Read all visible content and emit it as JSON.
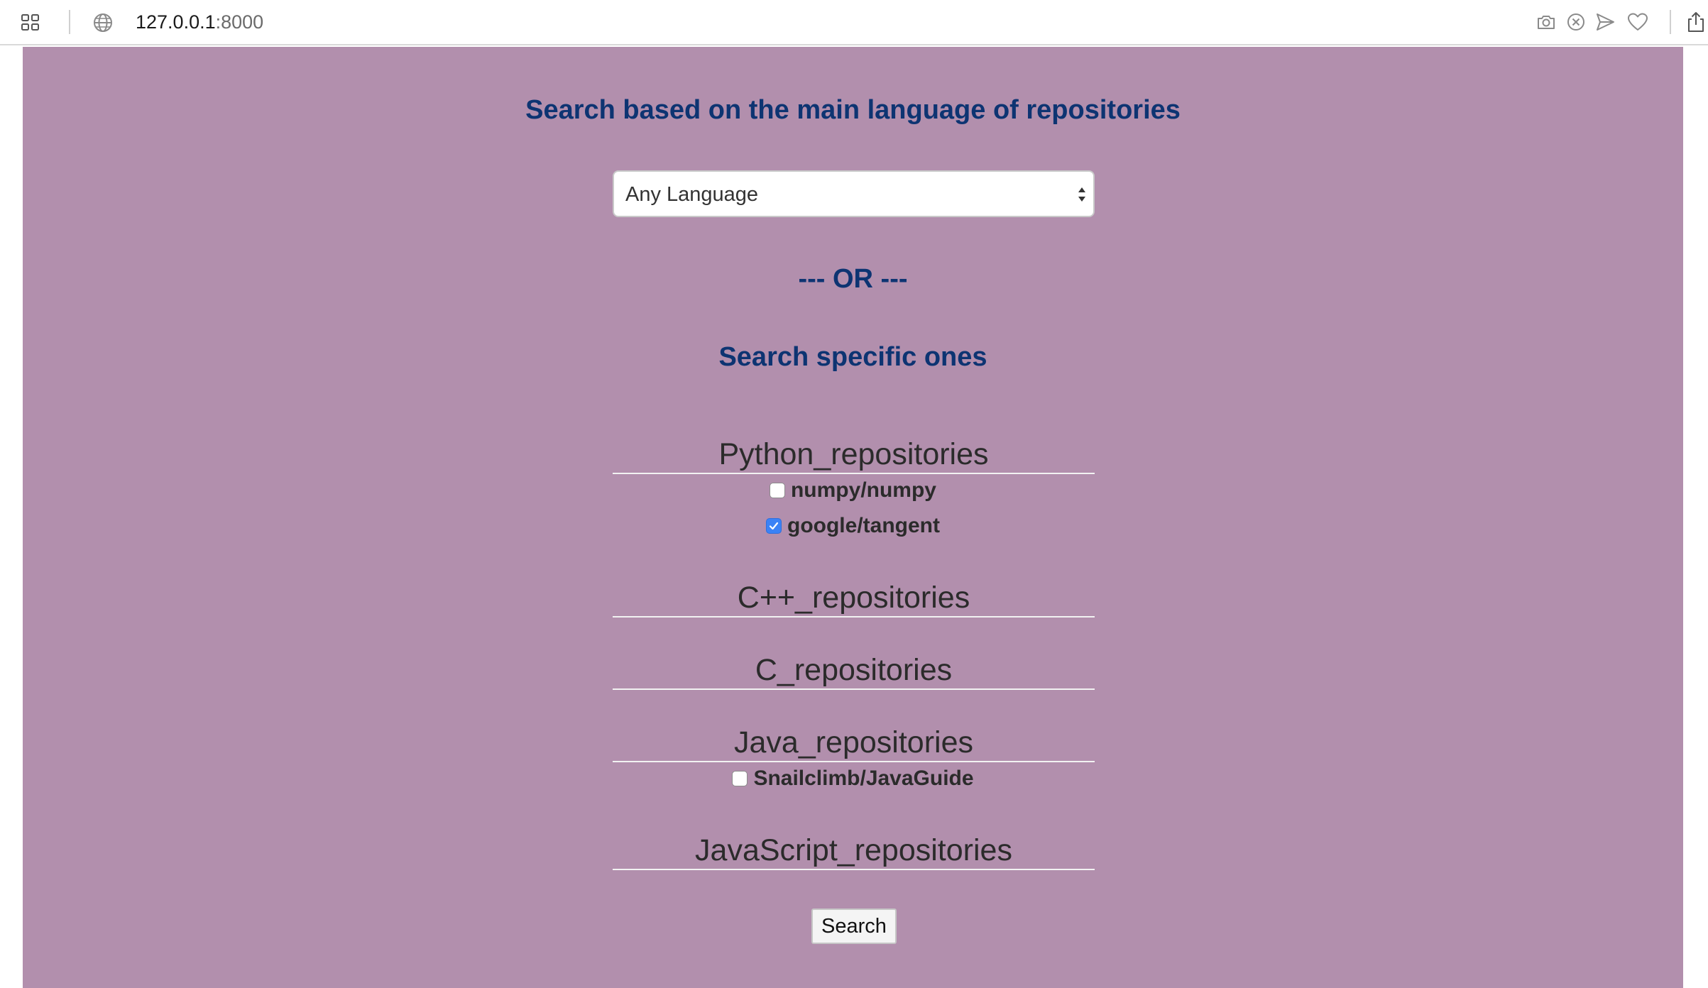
{
  "browser": {
    "url_host": "127.0.0.1",
    "url_port": ":8000",
    "icons": [
      "grid-icon",
      "globe-icon",
      "camera-icon",
      "close-circle-icon",
      "send-icon",
      "heart-icon",
      "share-icon"
    ]
  },
  "page": {
    "main_heading": "Search based on the main language of repositories",
    "language_select": {
      "selected": "Any Language"
    },
    "or_divider": "--- OR ---",
    "specific_heading": "Search specific ones",
    "groups": [
      {
        "title": "Python_repositories",
        "repos": [
          {
            "label": "numpy/numpy",
            "checked": false
          },
          {
            "label": "google/tangent",
            "checked": true
          }
        ]
      },
      {
        "title": "C++_repositories",
        "repos": []
      },
      {
        "title": "C_repositories",
        "repos": []
      },
      {
        "title": "Java_repositories",
        "repos": [
          {
            "label": "Snailclimb/JavaGuide",
            "checked": false
          }
        ]
      },
      {
        "title": "JavaScript_repositories",
        "repos": []
      }
    ],
    "search_button": "Search"
  },
  "colors": {
    "page_background": "#b28fad",
    "heading": "#0d3472",
    "checkbox_checked": "#3b82f6"
  }
}
